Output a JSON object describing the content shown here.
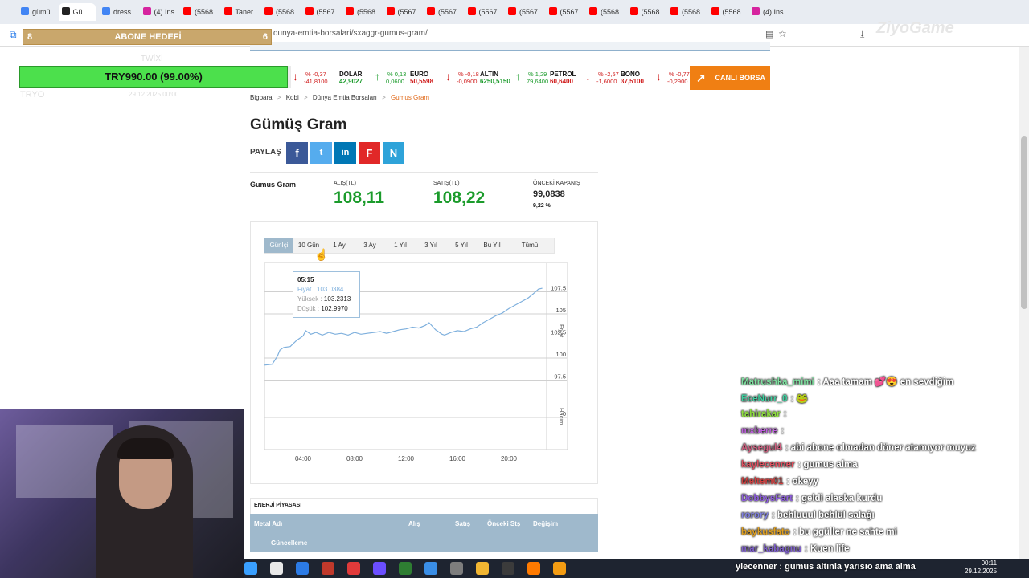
{
  "browser": {
    "tabs": [
      {
        "label": "gümü",
        "color": "#4285f4"
      },
      {
        "label": "Gü",
        "color": "#222222"
      },
      {
        "label": "dress",
        "color": "#4285f4"
      },
      {
        "label": "(4) Ins",
        "color": "#d6249f"
      },
      {
        "label": "(5568",
        "color": "#ff0000"
      },
      {
        "label": "Taner",
        "color": "#ff0000"
      },
      {
        "label": "(5568",
        "color": "#ff0000"
      },
      {
        "label": "(5567",
        "color": "#ff0000"
      },
      {
        "label": "(5568",
        "color": "#ff0000"
      },
      {
        "label": "(5567",
        "color": "#ff0000"
      },
      {
        "label": "(5567",
        "color": "#ff0000"
      },
      {
        "label": "(5567",
        "color": "#ff0000"
      },
      {
        "label": "(5567",
        "color": "#ff0000"
      },
      {
        "label": "(5567",
        "color": "#ff0000"
      },
      {
        "label": "(5568",
        "color": "#ff0000"
      },
      {
        "label": "(5568",
        "color": "#ff0000"
      },
      {
        "label": "(5568",
        "color": "#ff0000"
      },
      {
        "label": "(5568",
        "color": "#ff0000"
      },
      {
        "label": "(4) Ins",
        "color": "#d6249f"
      }
    ],
    "url": "dunya-emtia-borsalari/sxaggr-gumus-gram/"
  },
  "overlay": {
    "goal_left": "8",
    "goal_title": "ABONE HEDEFİ",
    "goal_right": "6",
    "donation": "TRY990.00 (99.00%)",
    "ghost_top": "TWİXİ",
    "ghost_left": "TRYO",
    "ghost_date": "29.12.2025 00:00"
  },
  "ticker": [
    {
      "name": "",
      "value": "",
      "pct": "% -0,37",
      "chg": "-41,8100",
      "dir": "down"
    },
    {
      "name": "DOLAR",
      "value": "42,9027",
      "pct": "% 0,13",
      "chg": "0,0600",
      "dir": "up"
    },
    {
      "name": "EURO",
      "value": "50,5598",
      "pct": "% -0,18",
      "chg": "-0,0900",
      "dir": "down"
    },
    {
      "name": "ALTIN",
      "value": "6250,5150",
      "pct": "% 1,29",
      "chg": "79,6400",
      "dir": "up"
    },
    {
      "name": "PETROL",
      "value": "60,6400",
      "pct": "% -2,57",
      "chg": "-1,6000",
      "dir": "down"
    },
    {
      "name": "BONO",
      "value": "37,5100",
      "pct": "% -0,77",
      "chg": "-0,2900",
      "dir": "down"
    }
  ],
  "canli_borsa": "CANLI BORSA",
  "breadcrumb": {
    "items": [
      "Bigpara",
      "Kobi",
      "Dünya Emtia Borsaları"
    ],
    "current": "Gumus Gram",
    "sep": ">"
  },
  "title": "Gümüş Gram",
  "share": {
    "label": "PAYLAŞ",
    "buttons": [
      "f",
      "t",
      "in",
      "F",
      "N"
    ]
  },
  "price": {
    "name": "Gumus Gram",
    "alis_label": "ALIŞ(TL)",
    "alis": "108,11",
    "satis_label": "SATIŞ(TL)",
    "satis": "108,22",
    "onceki_label": "ÖNCEKİ KAPANIŞ",
    "onceki": "99,0838",
    "change": "9,22 %"
  },
  "range_tabs": [
    "Günİçi",
    "10 Gün",
    "1 Ay",
    "3 Ay",
    "1 Yıl",
    "3 Yıl",
    "5 Yıl",
    "Bu Yıl",
    "Tümü"
  ],
  "tooltip": {
    "time": "05:15",
    "fiyat_label": "Fiyat :",
    "fiyat": "103.0384",
    "yuksek_label": "Yüksek :",
    "yuksek": "103.2313",
    "dusuk_label": "Düşük :",
    "dusuk": "102.9970"
  },
  "chart_data": {
    "type": "line",
    "ylabel": "Fiyat",
    "ylabel2": "Hacim",
    "x_ticks": [
      "04:00",
      "08:00",
      "12:00",
      "16:00",
      "20:00"
    ],
    "y_ticks": [
      97.5,
      100,
      102.5,
      105,
      107.5
    ],
    "y_ticks_labels": [
      "97.5",
      "100",
      "102.5",
      "105",
      "107.5"
    ],
    "volume_tick": "0",
    "ylim": [
      95,
      110
    ],
    "xlim": [
      1,
      23
    ],
    "series": [
      {
        "color": "#7fb0dd",
        "x": [
          1.0,
          1.6,
          2.0,
          2.2,
          2.5,
          3.0,
          3.5,
          4.0,
          4.2,
          4.6,
          5.0,
          5.5,
          6.0,
          6.5,
          7.0,
          7.5,
          8.0,
          8.5,
          9.0,
          9.5,
          10.0,
          10.5,
          11.0,
          11.5,
          12.0,
          12.5,
          13.0,
          13.5,
          13.8,
          14.3,
          14.8,
          15.0,
          15.5,
          16.0,
          16.5,
          17.0,
          17.5,
          18.0,
          18.5,
          19.0,
          19.5,
          20.0,
          20.5,
          21.0,
          21.5,
          22.0,
          22.3,
          22.6
        ],
        "y": [
          99.2,
          99.3,
          100.2,
          100.9,
          101.2,
          101.3,
          102.0,
          102.5,
          103.1,
          102.7,
          102.9,
          102.6,
          102.9,
          102.7,
          102.8,
          102.6,
          102.9,
          102.7,
          102.8,
          102.9,
          103.0,
          102.8,
          103.0,
          103.2,
          103.3,
          103.5,
          103.4,
          103.7,
          104.0,
          103.2,
          102.7,
          102.6,
          102.9,
          103.1,
          103.0,
          103.3,
          103.5,
          104.0,
          104.4,
          104.8,
          105.1,
          105.6,
          106.0,
          106.4,
          106.8,
          107.4,
          107.8,
          107.9
        ]
      }
    ]
  },
  "energy": {
    "title": "ENERJİ PİYASASI",
    "columns": [
      "Metal Adı",
      "Alış",
      "Satış",
      "Önceki Stş",
      "Değişim"
    ],
    "update_label": "Güncelleme"
  },
  "chat": [
    {
      "user": "Matrushka_mimi",
      "color": "#7fe0a0",
      "msg": "Aaa tamam 💕😍 en sevdiğim"
    },
    {
      "user": "EceNurr_0",
      "color": "#3fd0a0",
      "msg": "🐸"
    },
    {
      "user": "tahirakar",
      "color": "#90e040",
      "msg": ""
    },
    {
      "user": "mxberre",
      "color": "#c060e0",
      "msg": ""
    },
    {
      "user": "Aysegul4",
      "color": "#d06080",
      "msg": "abi abone olmadan döner atamıyor muyuz"
    },
    {
      "user": "kaylecenner",
      "color": "#e05060",
      "msg": "gumus alma"
    },
    {
      "user": "Meltem01",
      "color": "#d04040",
      "msg": "okeyy"
    },
    {
      "user": "DobbysFart",
      "color": "#9060e0",
      "msg": "geldi alaska kurdu"
    },
    {
      "user": "rorory",
      "color": "#8080e0",
      "msg": "behluuul behlül salağı"
    },
    {
      "user": "baykusfato",
      "color": "#e0a020",
      "msg": "bu ggüller ne sahte mi"
    },
    {
      "user": "mar_kabagnu",
      "color": "#8060d0",
      "msg": "Kuen life"
    }
  ],
  "bottom_ticker": "ylecenner : gumus altınla yarısıo ama alma",
  "clock": {
    "time": "00:11",
    "date": "29.12.2025"
  },
  "watermark": "ZiyoGame"
}
